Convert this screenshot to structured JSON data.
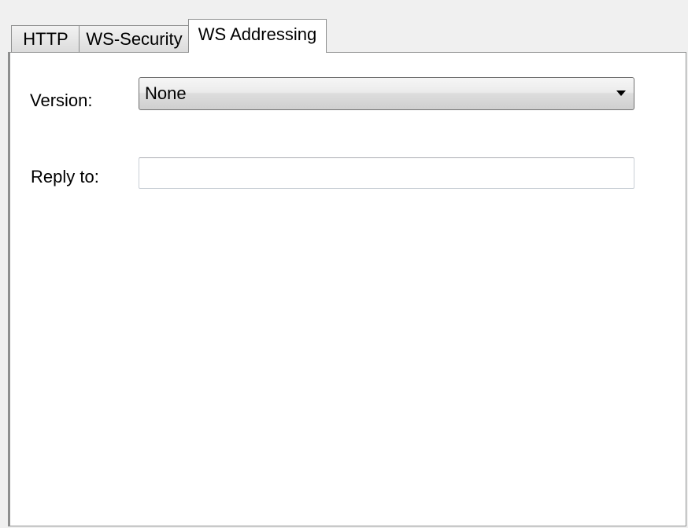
{
  "tabs": [
    {
      "label": "HTTP",
      "active": false
    },
    {
      "label": "WS-Security",
      "active": false
    },
    {
      "label": "WS Addressing",
      "active": true
    }
  ],
  "form": {
    "version_label": "Version:",
    "version_value": "None",
    "reply_to_label": "Reply to:",
    "reply_to_value": ""
  }
}
